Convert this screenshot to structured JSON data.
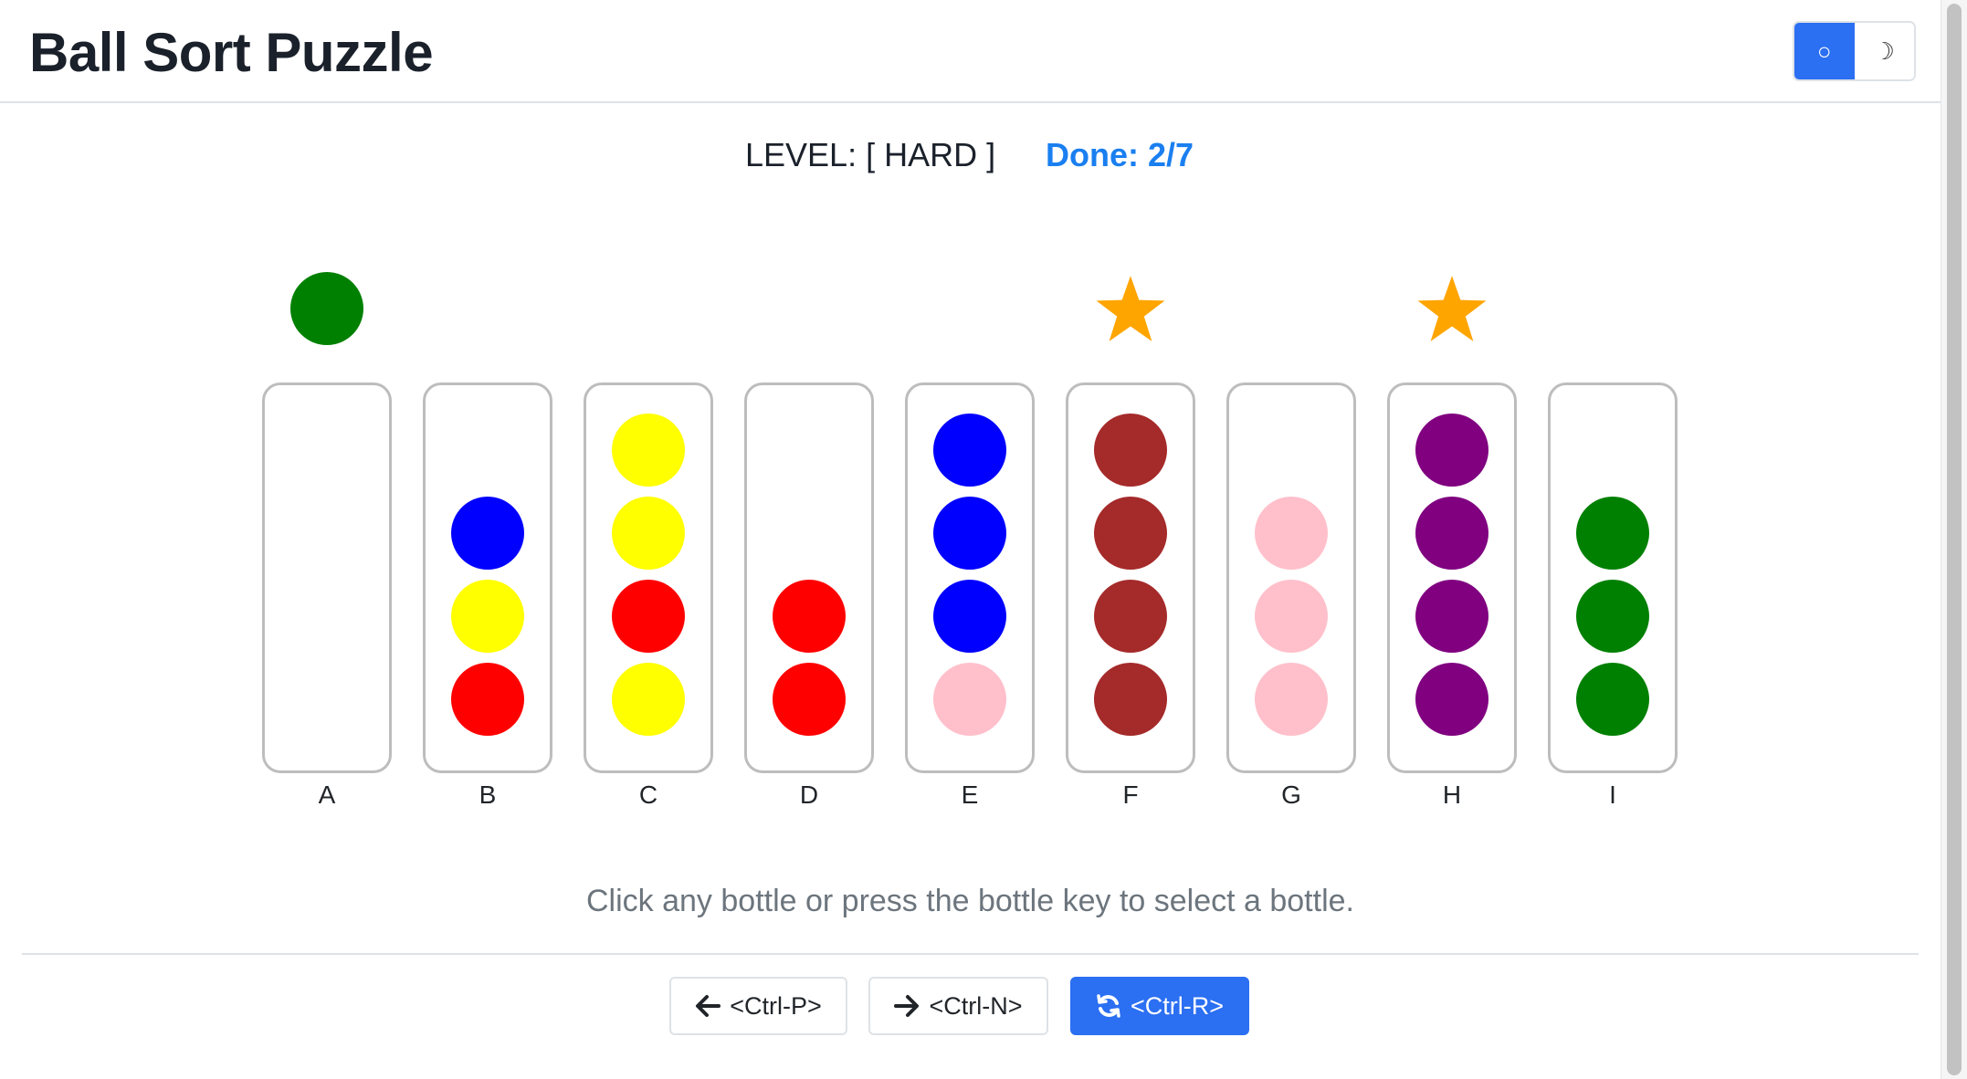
{
  "header": {
    "title": "Ball Sort Puzzle",
    "theme_light_icon": "○",
    "theme_dark_icon": "☽"
  },
  "status": {
    "level": "LEVEL: [ HARD ]",
    "done": "Done: 2/7"
  },
  "colors": {
    "green": "#008000",
    "blue": "#0000ff",
    "yellow": "#ffff00",
    "red": "#ff0000",
    "pink": "#ffc0cb",
    "brown": "#a52a2a",
    "purple": "#800080",
    "star": "#ffa500",
    "accent": "#2b6ff2",
    "done": "#1a7ff0"
  },
  "board": {
    "lifted_ball": {
      "bottle": "A",
      "color": "green"
    },
    "bottles": [
      {
        "label": "A",
        "balls_bottom_to_top": [],
        "completed": false
      },
      {
        "label": "B",
        "balls_bottom_to_top": [
          "red",
          "yellow",
          "blue"
        ],
        "completed": false
      },
      {
        "label": "C",
        "balls_bottom_to_top": [
          "yellow",
          "red",
          "yellow",
          "yellow"
        ],
        "completed": false
      },
      {
        "label": "D",
        "balls_bottom_to_top": [
          "red",
          "red"
        ],
        "completed": false
      },
      {
        "label": "E",
        "balls_bottom_to_top": [
          "pink",
          "blue",
          "blue",
          "blue"
        ],
        "completed": false
      },
      {
        "label": "F",
        "balls_bottom_to_top": [
          "brown",
          "brown",
          "brown",
          "brown"
        ],
        "completed": true
      },
      {
        "label": "G",
        "balls_bottom_to_top": [
          "pink",
          "pink",
          "pink"
        ],
        "completed": false
      },
      {
        "label": "H",
        "balls_bottom_to_top": [
          "purple",
          "purple",
          "purple",
          "purple"
        ],
        "completed": true
      },
      {
        "label": "I",
        "balls_bottom_to_top": [
          "green",
          "green",
          "green"
        ],
        "completed": false
      }
    ]
  },
  "hint": "Click any bottle or press the bottle key to select a bottle.",
  "controls": {
    "prev_label": "<Ctrl-P>",
    "next_label": "<Ctrl-N>",
    "restart_label": "<Ctrl-R>",
    "prev_icon": "arrow-left-icon",
    "next_icon": "arrow-right-icon",
    "restart_icon": "refresh-icon"
  }
}
